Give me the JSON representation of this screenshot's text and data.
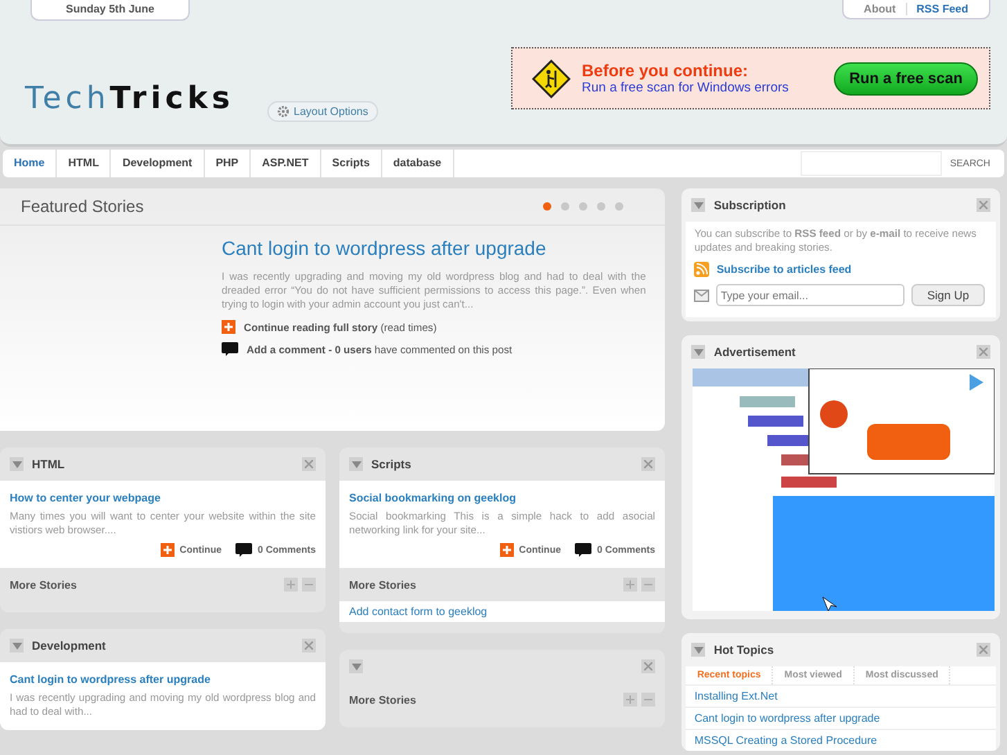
{
  "header": {
    "date": "Sunday 5th June",
    "top_links": [
      {
        "label": "About",
        "selected": false
      },
      {
        "label": "RSS Feed",
        "selected": true
      }
    ],
    "logo": {
      "part_1": "Tech",
      "part_2": "Tricks"
    },
    "layout_button": "Layout Options",
    "ad": {
      "title": "Before you continue:",
      "subtitle": "Run a free scan for Windows errors",
      "button": "Run a free scan"
    }
  },
  "nav": {
    "items": [
      {
        "label": "Home",
        "selected": true
      },
      {
        "label": "HTML",
        "selected": false
      },
      {
        "label": "Development",
        "selected": false
      },
      {
        "label": "PHP",
        "selected": false
      },
      {
        "label": "ASP.NET",
        "selected": false
      },
      {
        "label": "Scripts",
        "selected": false
      },
      {
        "label": "database",
        "selected": false
      }
    ],
    "search_button": "SEARCH"
  },
  "featured": {
    "title": "Featured Stories",
    "dots": [
      {
        "selected": true
      },
      {
        "selected": false
      },
      {
        "selected": false
      },
      {
        "selected": false
      },
      {
        "selected": false
      }
    ],
    "story_title": "Cant login to wordpress after upgrade",
    "story_text": "I was recently upgrading and moving my old wordpress blog and had to deal with the dreaded error “You do not have sufficient permissions to access this page.”. Even when trying to login with your admin account you just can't...",
    "continue": "**Continue reading full story** (read times)",
    "comment": "**Add a comment - 0 users** have commented on this post"
  },
  "widgets": [
    {
      "title": "HTML",
      "story_title": "How to center your webpage",
      "story_text": "Many times you will want to center your website within the site vistiors web browser....",
      "continue": "Continue",
      "comments": "0 Comments",
      "more": "More Stories"
    },
    {
      "title": "Scripts",
      "story_title": "Social bookmarking on geeklog",
      "story_text": "Social bookmarking This is a simple hack to add asocial networking link for your site...",
      "continue": "Continue",
      "comments": "0 Comments",
      "more": "More Stories",
      "more_links": [
        "Add contact form to geeklog"
      ]
    },
    {
      "title": "Development",
      "story_title": "Cant login to wordpress after upgrade",
      "story_text": "I was recently upgrading and moving my old wordpress blog and had to deal with..."
    },
    {
      "more": "More Stories"
    }
  ],
  "subscription": {
    "title": "Subscription",
    "text": "You can subscribe to **RSS feed** or by **e-mail** to receive news updates and breaking stories.",
    "feed_link": "Subscribe to articles feed",
    "email_placeholder": "Type your email...",
    "button": "Sign Up"
  },
  "advertisement": {
    "title": "Advertisement",
    "kind": "picture"
  },
  "hot_topics": {
    "title": "Hot Topics",
    "tabs": [
      {
        "label": "Recent topics",
        "selected": true
      },
      {
        "label": "Most viewed",
        "selected": false
      },
      {
        "label": "Most discussed",
        "selected": false
      }
    ],
    "items": [
      "Installing Ext.Net",
      "Cant login to wordpress after upgrade",
      "MSSQL Creating a Stored Procedure"
    ]
  }
}
